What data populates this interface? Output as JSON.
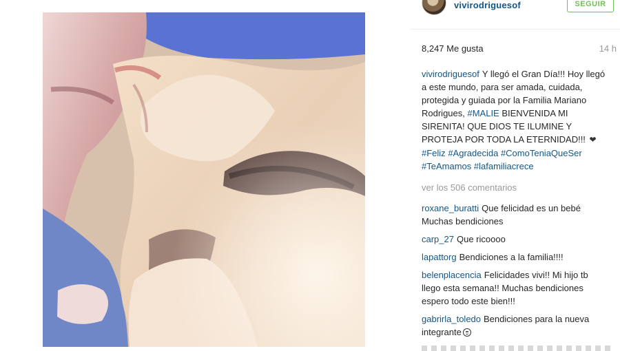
{
  "post": {
    "username": "vivirodriguesof",
    "follow_label": "SEGUIR",
    "likes": "8,247 Me gusta",
    "time": "14 h",
    "caption_user": "vivirodriguesof",
    "caption_parts": [
      "Y llegó el Gran Día!!! Hoy llegó a este mundo, para ser amada, cuidada, protegida y guiada por la Familia Mariano Rodrigues, ",
      "#MALIE",
      " BIENVENIDA MI SIRENITA! QUE DIOS TE ILUMINE Y PROTEJA POR TODA LA ETERNIDAD!!! ",
      "#Feliz",
      " ",
      "#Agradecida",
      " ",
      "#ComoTeniaQueSer",
      " ",
      "#TeAmamos",
      " ",
      "#lafamiliacrece"
    ],
    "heart_symbol": "❤",
    "view_comments": "ver los 506 comentarios",
    "comments": [
      {
        "user": "roxane_buratti",
        "text": "Que felicidad es un bebé Muchas bendiciones"
      },
      {
        "user": "carp_27",
        "text": "Que ricoooo"
      },
      {
        "user": "lapattorg",
        "text": "Bendiciones a la familia!!!!"
      },
      {
        "user": "belenplacencia",
        "text": "Felicidades vivi!! Mi hijo tb llego esta semana!! Muchas bendiciones espero todo este bien!!!"
      },
      {
        "user": "gabrirla_toledo",
        "text": "Bendiciones para la nueva integrante"
      }
    ]
  },
  "icons": {
    "avatar": "profile-avatar",
    "emoji": "smile-emoji-icon",
    "heart": "heart-icon"
  },
  "colors": {
    "username_link": "#125688",
    "follow_green": "#70c050",
    "muted": "#999999"
  }
}
